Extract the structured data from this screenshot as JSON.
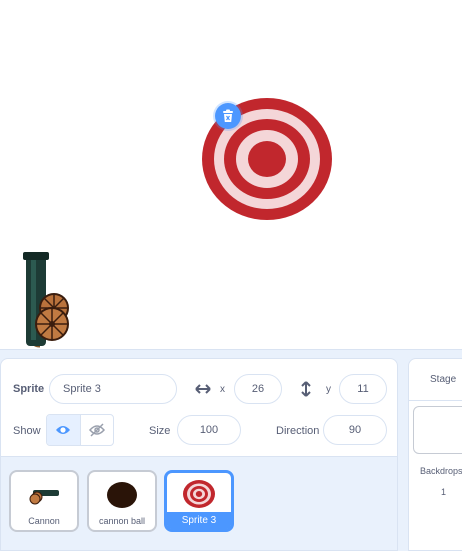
{
  "sprite_info": {
    "sprite_label": "Sprite",
    "sprite_name": "Sprite 3",
    "x_label": "x",
    "x_value": "26",
    "y_label": "y",
    "y_value": "11",
    "show_label": "Show",
    "size_label": "Size",
    "size_value": "100",
    "direction_label": "Direction",
    "direction_value": "90"
  },
  "sprites": [
    {
      "name": "Cannon",
      "icon": "cannon-thumbnail",
      "selected": false
    },
    {
      "name": "cannon ball",
      "icon": "cannon-ball-thumbnail",
      "selected": false
    },
    {
      "name": "Sprite 3",
      "icon": "target-thumbnail",
      "selected": true
    }
  ],
  "stage_panel": {
    "title": "Stage",
    "backdrops_label": "Backdrops",
    "backdrops_count": "1"
  },
  "colors": {
    "accent": "#4c97ff",
    "target_red": "#c1272d",
    "target_pink": "#f4d6d8",
    "panel_bg": "#e9f1fc"
  }
}
